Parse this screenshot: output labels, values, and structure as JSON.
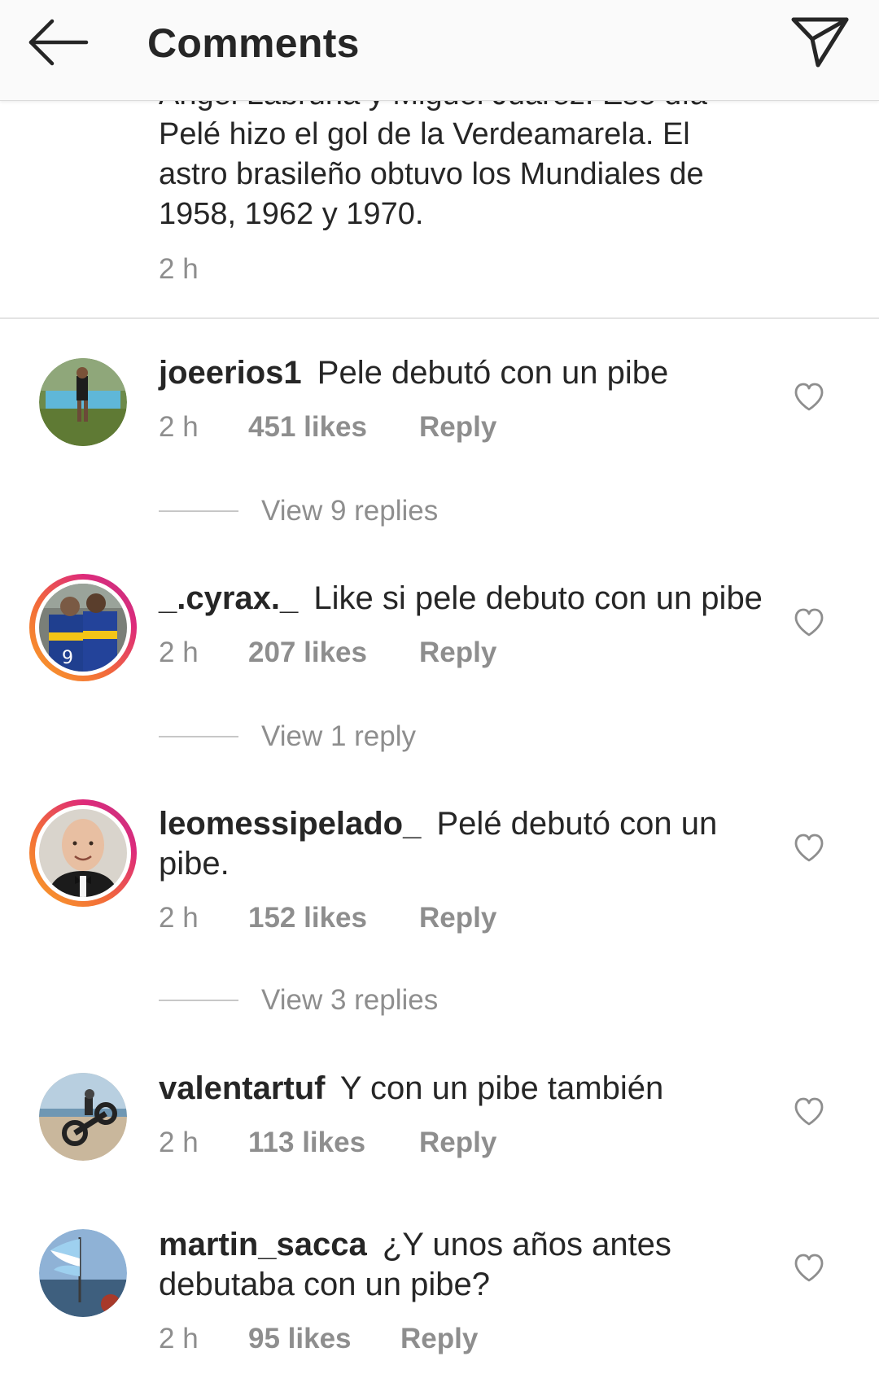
{
  "header": {
    "title": "Comments",
    "back_icon": "arrow-left-icon",
    "share_icon": "paper-plane-icon"
  },
  "caption": {
    "line0": "Ángel Labruna y Miguel Juárez. Ese día",
    "line1": "Pelé hizo el gol de la Verdeamarela. El",
    "line2": "astro brasileño obtuvo los Mundiales de",
    "line3": "1958, 1962 y 1970.",
    "time": "2 h"
  },
  "comments": [
    {
      "username": "joeerios1",
      "text": "Pele debutó con un pibe",
      "time": "2 h",
      "likes": "451 likes",
      "reply": "Reply",
      "view_replies": "View 9 replies",
      "story_ring": false
    },
    {
      "username": "_.cyrax._",
      "text": "Like si pele debuto con un pibe",
      "time": "2 h",
      "likes": "207 likes",
      "reply": "Reply",
      "view_replies": "View 1 reply",
      "story_ring": true
    },
    {
      "username": "leomessipelado_",
      "text": "Pelé debutó con un pibe.",
      "time": "2 h",
      "likes": "152 likes",
      "reply": "Reply",
      "view_replies": "View 3 replies",
      "story_ring": true
    },
    {
      "username": "valentartuf",
      "text": "Y con un pibe también",
      "time": "2 h",
      "likes": "113 likes",
      "reply": "Reply",
      "story_ring": false
    },
    {
      "username": "martin_sacca",
      "text": "¿Y unos años antes debutaba con un pibe?",
      "time": "2 h",
      "likes": "95 likes",
      "reply": "Reply",
      "story_ring": false
    }
  ],
  "colors": {
    "text": "#262626",
    "muted": "#8e8e8e",
    "header_bg": "#fafafa",
    "ring_start": "#f9a227",
    "ring_end": "#c13584"
  }
}
